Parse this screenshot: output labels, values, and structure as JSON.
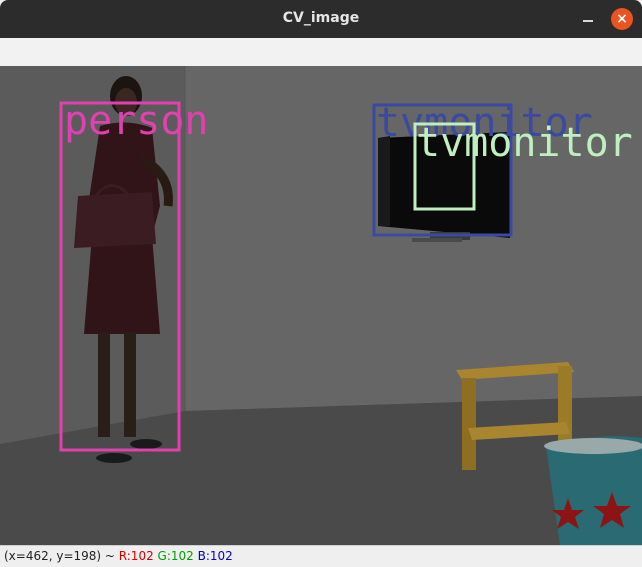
{
  "window": {
    "title": "CV_image",
    "close_glyph": "×"
  },
  "detections": [
    {
      "label": "person",
      "color": "#e040b0"
    },
    {
      "label": "tvmonitor",
      "color": "#3a4aa0"
    },
    {
      "label": "tvmonitor",
      "color": "#bfeebf"
    }
  ],
  "status": {
    "coords": "(x=462, y=198) ~ ",
    "r": "R:102",
    "g": "G:102",
    "b": "B:102"
  },
  "colors": {
    "accent_close": "#e95420",
    "titlebar": "#2c2c2c"
  }
}
